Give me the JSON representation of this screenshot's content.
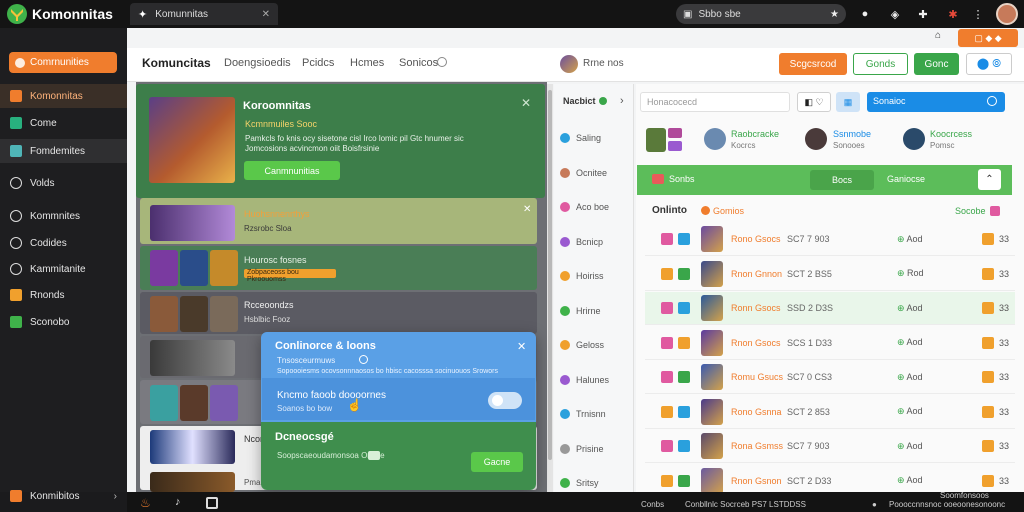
{
  "topbar": {
    "brand": "Komonnitas",
    "tab_title": "Komunnitas",
    "tab_close": "✕",
    "search_value": "Sbbo sbe"
  },
  "sidebar": {
    "primary_button": "Comrnunities",
    "items": [
      {
        "label": "Komonnitas",
        "icon": "orange-grid-icon",
        "color": "#f07d2d"
      },
      {
        "label": "Come",
        "icon": "teal-person-icon",
        "color": "#28b07e"
      },
      {
        "label": "Fomdemites",
        "icon": "teal-folder-icon",
        "color": "#4fb5b7"
      },
      {
        "label": "Volds",
        "icon": "chat-icon",
        "color": "#dddddd"
      },
      {
        "label": "Kommnites",
        "icon": "people-icon",
        "color": "#dddddd"
      },
      {
        "label": "Codides",
        "icon": "search-icon",
        "color": "#dddddd"
      },
      {
        "label": "Kammitanite",
        "icon": "globe-icon",
        "color": "#dddddd"
      },
      {
        "label": "Rnonds",
        "icon": "orange-book-icon",
        "color": "#f0a02d"
      },
      {
        "label": "Sconobo",
        "icon": "green-flag-icon",
        "color": "#3fb24a"
      }
    ],
    "footer_label": "Konmibitos"
  },
  "header": {
    "title": "Komuncitas",
    "nav": [
      "Doengsioedis",
      "Pcidcs",
      "Hcmes",
      "Sonicos"
    ],
    "user_label": "Rrne nos",
    "btn_orange": "Scgcsrcod",
    "btn_outline": "Gonds",
    "btn_green": "Gonc",
    "colors": {
      "orange": "#f07d2d",
      "green": "#3aa64a",
      "blue": "#1a8ce6"
    }
  },
  "featured": {
    "title": "Koroomnitas",
    "subtitle": "Kcmnmuiles Sooc",
    "desc1": "Pamkcls fo knis ocy sisetone cisl Irco lomic pil Gtc hnumer sic",
    "desc2": "Jomcosions acvincmon oiit Boisfrsinie",
    "button": "Canmnunitias"
  },
  "cards": [
    {
      "title": "Huohsnnenrthys",
      "meta": "Rzsrobc Sloa"
    },
    {
      "title": "Hourosc fosnes",
      "meta": "Zobpaceoss bou Pkroouomss"
    },
    {
      "title": "Rcceoondzs",
      "meta": "Hsblbic Fooz"
    },
    {
      "title": "Ncomms",
      "meta": "Pmanitos"
    }
  ],
  "popup": {
    "title": "Conlinorce & loons",
    "line1": "Tnsosceurmuws",
    "line2": "Sopoooiesms ocovsonnnaosos bo hbisc cacosssa socinuouos Srowors",
    "row_title": "Kncmo faoob doooornes",
    "row_sub": "Soanos bo bow",
    "section_title": "Dcneocsgé",
    "section_desc": "Soopscaeoudamonsoa Omide",
    "action": "Gacne"
  },
  "midpanel": {
    "header": "Nacbict",
    "items": [
      {
        "label": "Saling",
        "color": "#2aa0dd"
      },
      {
        "label": "Ocnitee",
        "color": "#c77a5a"
      },
      {
        "label": "Aco boe",
        "color": "#e05aa0"
      },
      {
        "label": "Bcnicp",
        "color": "#9a5ad0"
      },
      {
        "label": "Hoiriss",
        "color": "#f0a02d"
      },
      {
        "label": "Hrirne",
        "color": "#3fb24a"
      },
      {
        "label": "Geloss",
        "color": "#f0a02d"
      },
      {
        "label": "Halunes",
        "color": "#9a5ad0"
      },
      {
        "label": "Trnisnn",
        "color": "#2aa0dd"
      },
      {
        "label": "Prisine",
        "color": "#999999"
      },
      {
        "label": "Sritsy",
        "color": "#3fb24a"
      }
    ]
  },
  "right": {
    "search_placeholder": "Honacocecd",
    "blue_search": "Sonaioc",
    "users": [
      {
        "name": "Raobcracke",
        "sub": "Kocrcs"
      },
      {
        "name": "Ssnmobe",
        "sub": "Sonooes"
      },
      {
        "name": "Koocrcess",
        "sub": "Pomsc"
      }
    ],
    "green_bar": {
      "left": "Sonbs",
      "mid": "Bocs",
      "right": "Ganiocse"
    },
    "list_title": "Onlinto",
    "list_badge": "Gomios",
    "list_count": "Socobe",
    "rows": [
      {
        "name": "Rono Gsocs",
        "meta": "SC7 7 903",
        "action": "Aod",
        "num": "33"
      },
      {
        "name": "Rnon Gnnon",
        "meta": "SCT 2 BS5",
        "action": "Rod",
        "num": "33"
      },
      {
        "name": "Ronn Gsocs",
        "meta": "SSD 2 D3S",
        "action": "Aod",
        "num": "33"
      },
      {
        "name": "Rnon Gsocs",
        "meta": "SCS 1 D33",
        "action": "Aod",
        "num": "33"
      },
      {
        "name": "Romu Gsucs",
        "meta": "SC7 0 CS3",
        "action": "Aod",
        "num": "33"
      },
      {
        "name": "Rono Gsnna",
        "meta": "SCT 2 853",
        "action": "Aod",
        "num": "33"
      },
      {
        "name": "Rona Gsmss",
        "meta": "SC7 7 903",
        "action": "Aod",
        "num": "33"
      },
      {
        "name": "Rnon Gsnon",
        "meta": "SCT 2 D33",
        "action": "Aod",
        "num": "33"
      }
    ]
  },
  "bottombar": {
    "left": "Conbs",
    "mid": "Conbllnlc Socrceb PS7 LSTDDSS",
    "right": "Poooccnnsnoc ooeoonesonoonc",
    "far": "Soomfonsoos"
  }
}
